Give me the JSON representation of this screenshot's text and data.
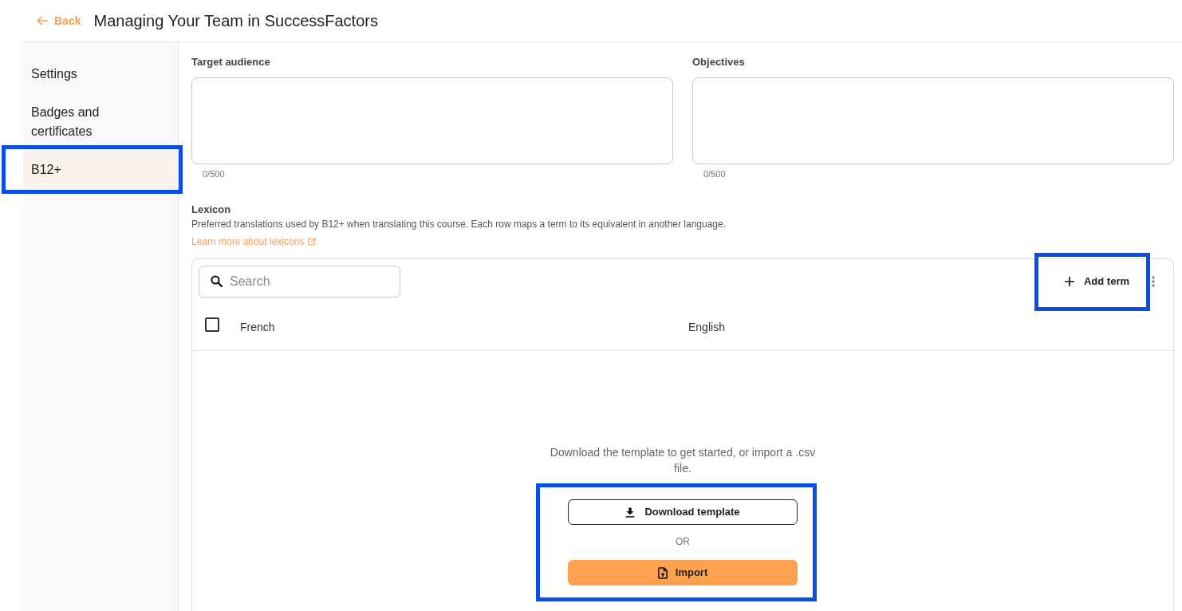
{
  "header": {
    "back_label": "Back",
    "title": "Managing Your Team in SuccessFactors"
  },
  "sidebar": {
    "items": [
      {
        "label": "Settings",
        "selected": false,
        "highlighted": false
      },
      {
        "label": "Badges and certificates",
        "selected": false,
        "highlighted": false
      },
      {
        "label": "B12+",
        "selected": true,
        "highlighted": true
      }
    ]
  },
  "fields": [
    {
      "label": "Target audience",
      "counter": "0/500"
    },
    {
      "label": "Objectives",
      "counter": "0/500"
    }
  ],
  "lexicon": {
    "title": "Lexicon",
    "description": "Preferred translations used by B12+ when translating this course. Each row maps a term to its equivalent in another language.",
    "link": "Learn more about lexicons",
    "search": {
      "placeholder": "Search"
    },
    "add_button": {
      "label": "Add term",
      "highlighted": true
    },
    "select_all": {
      "checked": false
    },
    "columns": [
      {
        "label": "French"
      },
      {
        "label": "English"
      }
    ],
    "empty_state": {
      "message": "Download the template to get started, or import a .csv file.",
      "download_button": "Download template",
      "separator": "OR",
      "import_button": "Import",
      "highlighted": true
    }
  }
}
